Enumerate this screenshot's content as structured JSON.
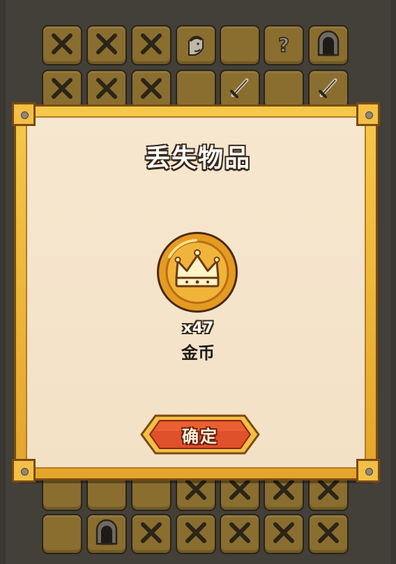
{
  "dialog": {
    "title": "丢失物品",
    "item": {
      "icon": "gold-coin-crown-icon",
      "quantity": "x47",
      "name": "金币"
    },
    "confirm_label": "确定"
  },
  "board": {
    "tiles_top": [
      "x-mark-icon",
      "x-mark-icon",
      "x-mark-icon",
      "warrior-portrait-icon",
      "empty",
      "question-mark-icon",
      "dungeon-door-icon",
      "x-mark-icon",
      "x-mark-icon",
      "x-mark-icon",
      "empty",
      "sword-icon",
      "empty",
      "sword-icon"
    ],
    "tiles_bottom": [
      "empty",
      "empty",
      "empty",
      "x-mark-icon",
      "x-mark-icon",
      "x-mark-icon",
      "x-mark-icon",
      "empty",
      "dungeon-door-icon",
      "x-mark-icon",
      "x-mark-icon",
      "x-mark-icon",
      "x-mark-icon",
      "x-mark-icon"
    ]
  },
  "colors": {
    "tile": "#8a6e2f",
    "frame_gold": "#f2bd45",
    "panel": "#f5e5cc",
    "button_red": "#e0502a"
  }
}
